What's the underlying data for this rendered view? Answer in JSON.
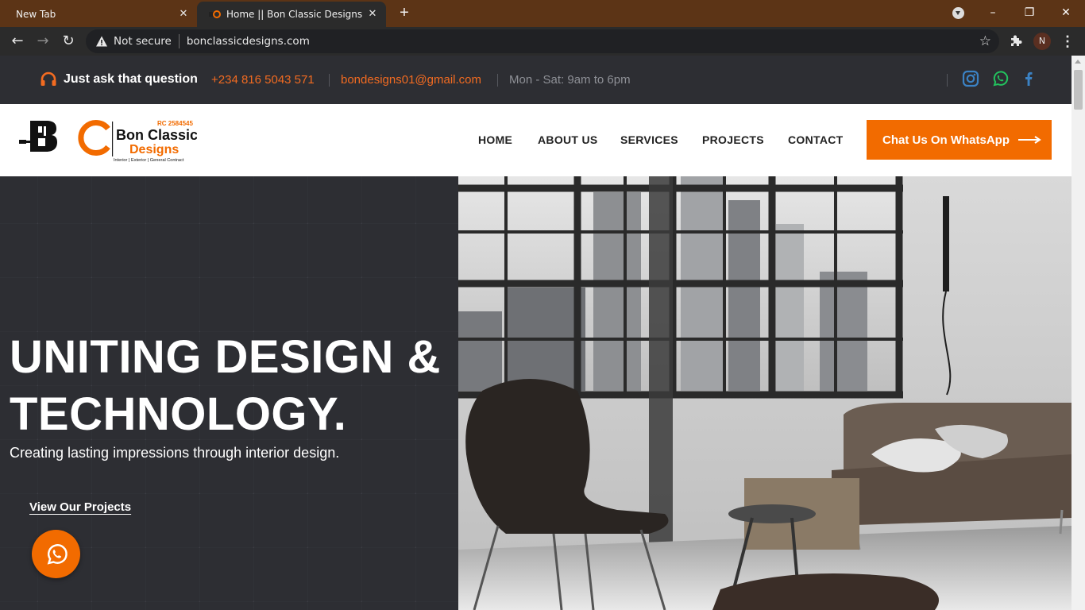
{
  "browser": {
    "tabs": [
      {
        "title": "New Tab",
        "active": false
      },
      {
        "title": "Home || Bon Classic Designs",
        "active": true
      }
    ],
    "security_label": "Not secure",
    "url": "bonclassicdesigns.com",
    "profile_initial": "N"
  },
  "topbar": {
    "ask": "Just ask that question",
    "phone": "+234 816 5043 571",
    "email": "bondesigns01@gmail.com",
    "hours": "Mon - Sat: 9am to 6pm"
  },
  "logo": {
    "rc": "RC 2584545",
    "name_line1": "Bon Classic",
    "name_line2": "Designs",
    "tagline": "Interior | Exterior | General Contract"
  },
  "nav": {
    "items": [
      {
        "label": "HOME"
      },
      {
        "label": "ABOUT US"
      },
      {
        "label": "SERVICES"
      },
      {
        "label": "PROJECTS"
      },
      {
        "label": "CONTACT"
      }
    ],
    "cta": "Chat Us On WhatsApp"
  },
  "hero": {
    "headline_line1": "UNITING DESIGN &",
    "headline_line2": "TECHNOLOGY.",
    "subheadline": "Creating lasting impressions through interior design.",
    "link": "View Our Projects"
  },
  "colors": {
    "accent": "#f26b00",
    "dark_bg": "#2d2e33",
    "tabbar": "#5c3416"
  }
}
